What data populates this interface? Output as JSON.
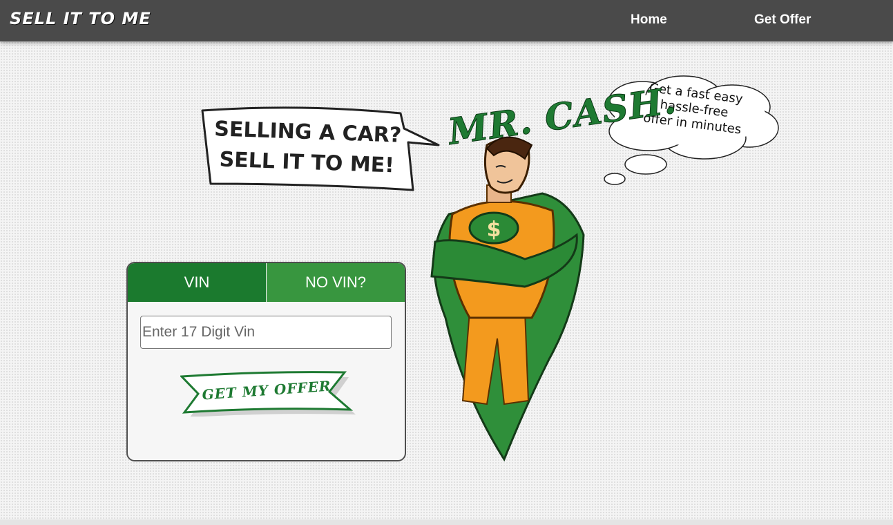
{
  "header": {
    "brand": "SELL IT TO ME",
    "nav": {
      "home": "Home",
      "get_offer": "Get Offer"
    }
  },
  "hero": {
    "speech_line1": "SELLING A CAR?",
    "speech_line2": "SELL IT TO ME!",
    "mascot_name": "MR. CASH.",
    "thought_line1": "Get a fast easy",
    "thought_line2": "hassle-free",
    "thought_line3": "offer in minutes",
    "badge_symbol": "$"
  },
  "form": {
    "tabs": [
      "VIN",
      "NO VIN?"
    ],
    "vin_placeholder": "Enter 17 Digit Vin",
    "submit_label": "GET MY OFFER"
  },
  "colors": {
    "nav_bg": "#4a4a4a",
    "tab_active": "#1b7a2e",
    "tab_inactive": "#38963f",
    "brand_green": "#1e7a32",
    "suit_orange": "#f39a1e"
  }
}
